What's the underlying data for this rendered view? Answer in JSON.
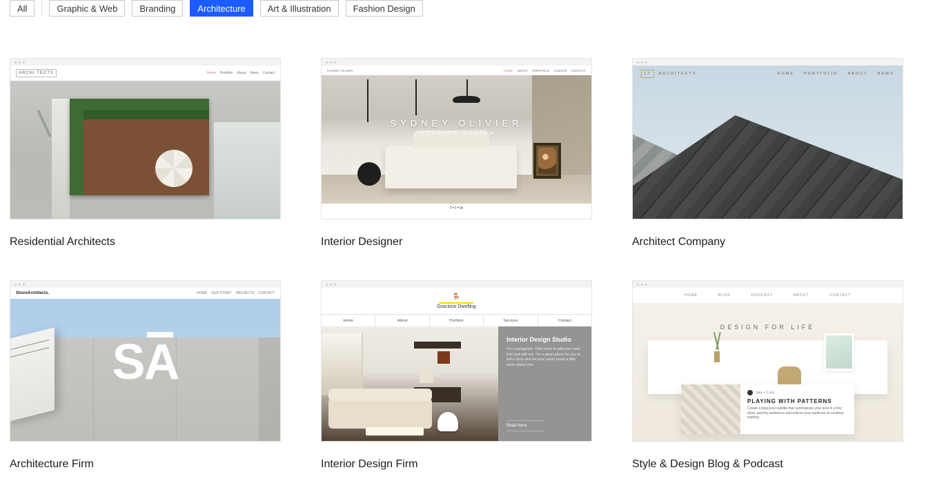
{
  "filters": {
    "items": [
      {
        "label": "All",
        "divider_after": true
      },
      {
        "label": "Graphic & Web"
      },
      {
        "label": "Branding"
      },
      {
        "label": "Architecture",
        "active": true
      },
      {
        "label": "Art & Illustration"
      },
      {
        "label": "Fashion Design"
      }
    ]
  },
  "templates": [
    {
      "title": "Residential Architects",
      "mini": {
        "logo": "ARCHI\nTECTS",
        "nav": [
          "Home",
          "Portfolio",
          "About",
          "News",
          "Contact"
        ],
        "nav_accent_index": 0
      }
    },
    {
      "title": "Interior Designer",
      "mini": {
        "brand": "SYDNEY OLIVIER",
        "nav": [
          "HOME",
          "ABOUT",
          "PORTFOLIO",
          "CLIENTS",
          "CONTACT"
        ],
        "nav_accent_index": 0,
        "hero_name": "SYDNEY OLIVIER",
        "hero_sub": "INTERIOR DESIGN",
        "footer_icons": "f  •  t  •  in"
      }
    },
    {
      "title": "Architect Company",
      "mini": {
        "logo": "LT",
        "logo_text": "ARCHITECTS",
        "nav": [
          "HOME",
          "PORTFOLIO",
          "ABOUT",
          "NEWS"
        ]
      }
    },
    {
      "title": "Architecture Firm",
      "mini": {
        "brand": "ShureArchitects.",
        "nav": [
          "HOME",
          "OUR STORY",
          "PROJECTS",
          "CONTACT"
        ],
        "sa": "S",
        "sa2": "A"
      }
    },
    {
      "title": "Interior Design Firm",
      "mini": {
        "logo": "Gracious Dwelling",
        "logo_icon": "🪑",
        "nav": [
          "Home",
          "About",
          "Portfolio",
          "Services",
          "Contact"
        ],
        "side_title": "Interior Design Studio",
        "side_body": "I'm a paragraph. Click here to add your own text and edit me. I'm a great place for you to tell a story and let your users know a little more about you.",
        "side_btn": "Read more"
      }
    },
    {
      "title": "Style & Design Blog & Podcast",
      "mini": {
        "nav": [
          "HOME",
          "BLOG",
          "PODCAST",
          "ABOUT",
          "CONTACT"
        ],
        "title": "DESIGN FOR LIFE",
        "post_meta": "Jake • 2 min",
        "post_title": "PLAYING WITH PATTERNS",
        "post_body": "Create a blog post subtitle that summarizes your post in a few short, punchy sentences and entices your audience to continue reading.",
        "post_more": "⋯"
      }
    }
  ]
}
